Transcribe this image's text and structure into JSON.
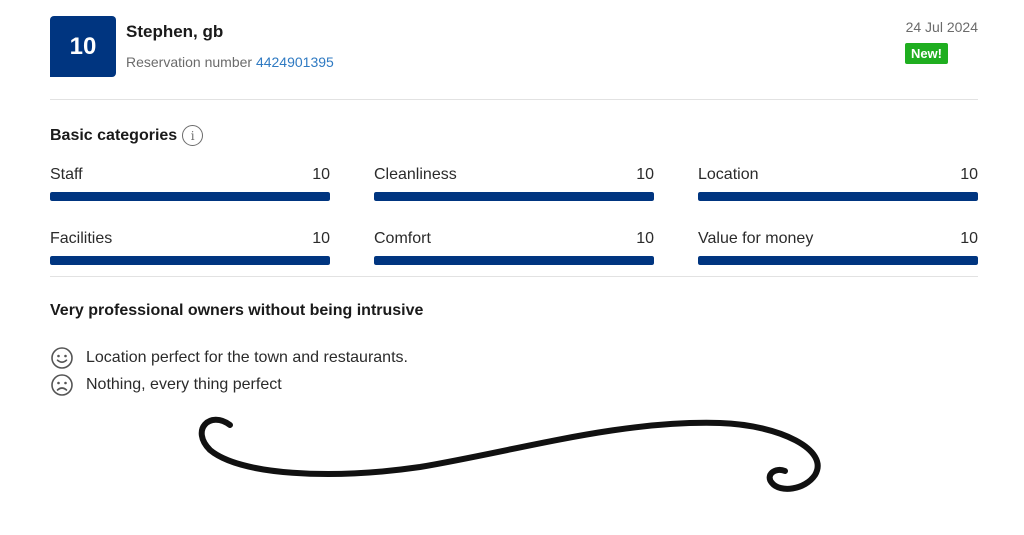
{
  "header": {
    "score": "10",
    "reviewer_name": "Stephen, gb",
    "reservation_label": "Reservation number",
    "reservation_number": "4424901395",
    "date": "24 Jul 2024",
    "new_badge": "New!"
  },
  "categories": {
    "title": "Basic categories",
    "max_score": 10,
    "items": [
      {
        "name": "Staff",
        "score": "10",
        "value": 10
      },
      {
        "name": "Cleanliness",
        "score": "10",
        "value": 10
      },
      {
        "name": "Location",
        "score": "10",
        "value": 10
      },
      {
        "name": "Facilities",
        "score": "10",
        "value": 10
      },
      {
        "name": "Comfort",
        "score": "10",
        "value": 10
      },
      {
        "name": "Value for money",
        "score": "10",
        "value": 10
      }
    ]
  },
  "review": {
    "title": "Very professional owners without being intrusive",
    "positive": "Location perfect for the town and restaurants.",
    "negative": "Nothing, every thing perfect"
  },
  "icons": {
    "info": "info-icon",
    "positive": "smiley-face-icon",
    "negative": "frown-face-icon"
  },
  "colors": {
    "brand_blue": "#003580",
    "new_badge_green": "#1fae20",
    "link_blue": "#2f7ac2"
  }
}
